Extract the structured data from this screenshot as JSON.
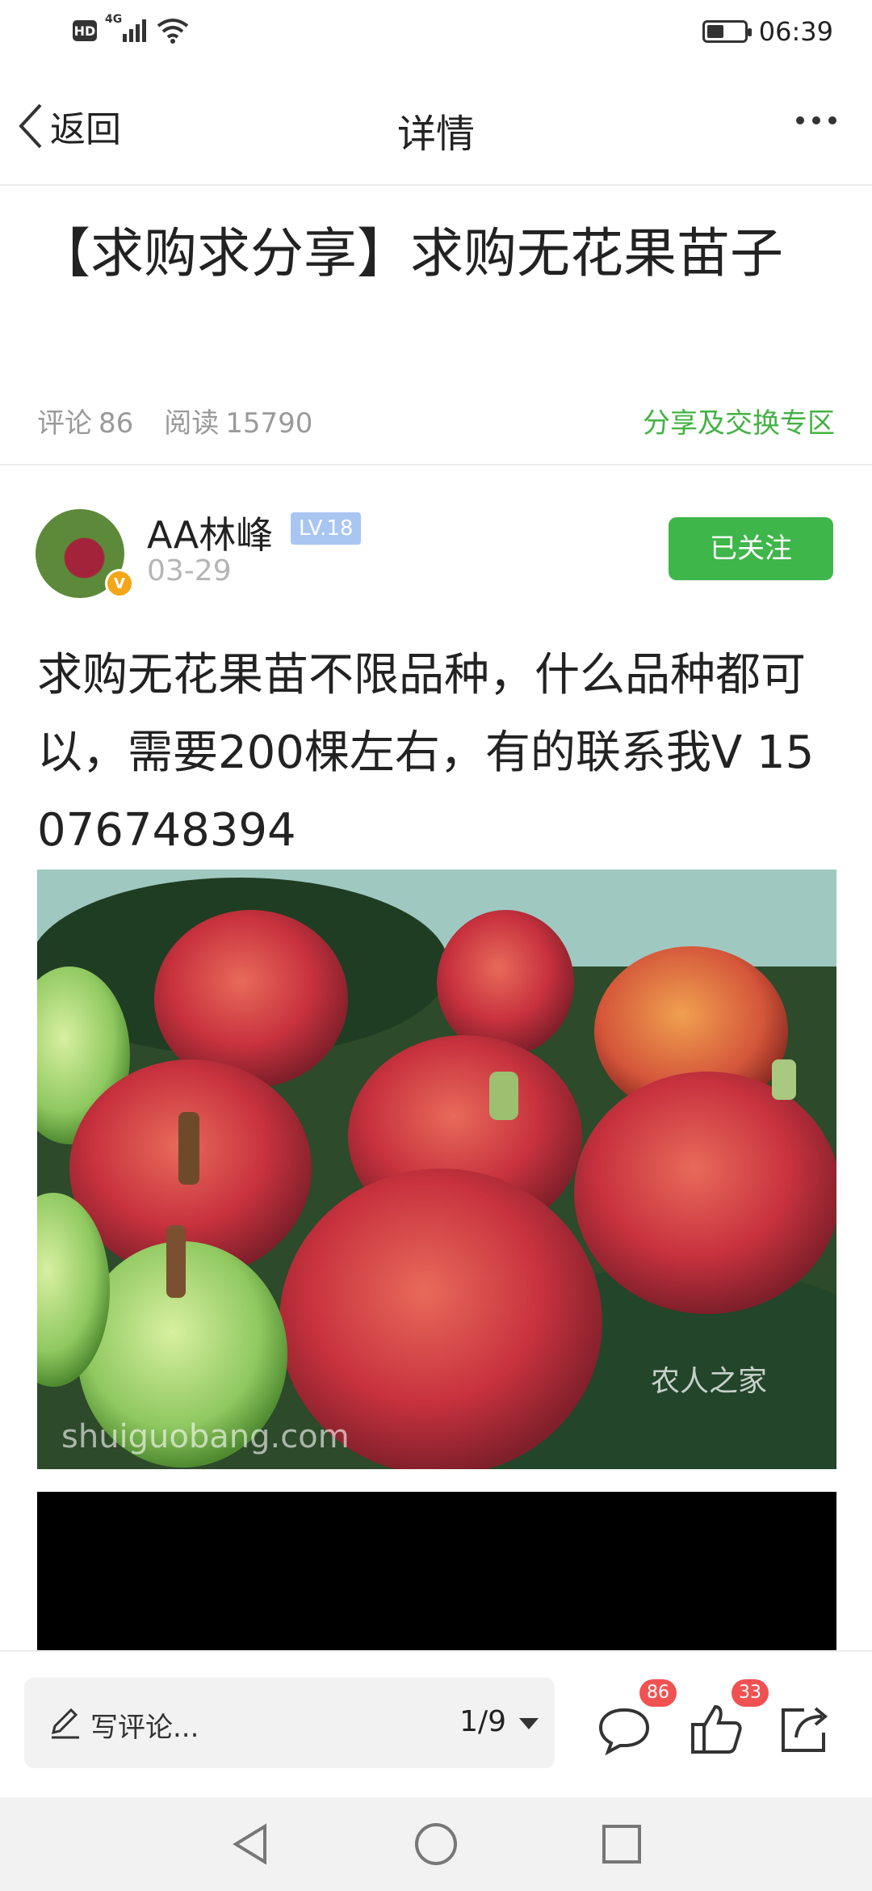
{
  "status_bar": {
    "hd_label": "HD",
    "network_label": "4G",
    "time": "06:39",
    "battery_level": 0.45
  },
  "navbar": {
    "back_label": "返回",
    "title": "详情"
  },
  "article": {
    "title": "【求购求分享】求购无花果苗子",
    "comment_label": "评论",
    "comment_count": "86",
    "read_label": "阅读",
    "read_count": "15790",
    "zone_link": "分享及交换专区"
  },
  "author": {
    "name": "AA林峰",
    "level": "LV.18",
    "date": "03-29",
    "verified_badge": "V",
    "follow_label": "已关注"
  },
  "post": {
    "body": "求购无花果苗不限品种，什么品种都可以，需要200棵左右，有的联系我V 15076748394",
    "image_watermark_right": "农人之家",
    "image_watermark_left": "shuiguobang.com"
  },
  "bottom_bar": {
    "comment_placeholder": "写评论...",
    "pager": "1/9",
    "comment_badge": "86",
    "like_badge": "33"
  },
  "colors": {
    "accent_green": "#3fb64a",
    "badge_red": "#f05252",
    "level_blue": "#a9c6f3"
  },
  "icons": [
    "back-chevron-icon",
    "more-icon",
    "pencil-icon",
    "dropdown-caret-icon",
    "comment-icon",
    "like-icon",
    "share-icon",
    "sys-back-icon",
    "sys-home-icon",
    "sys-recents-icon"
  ]
}
